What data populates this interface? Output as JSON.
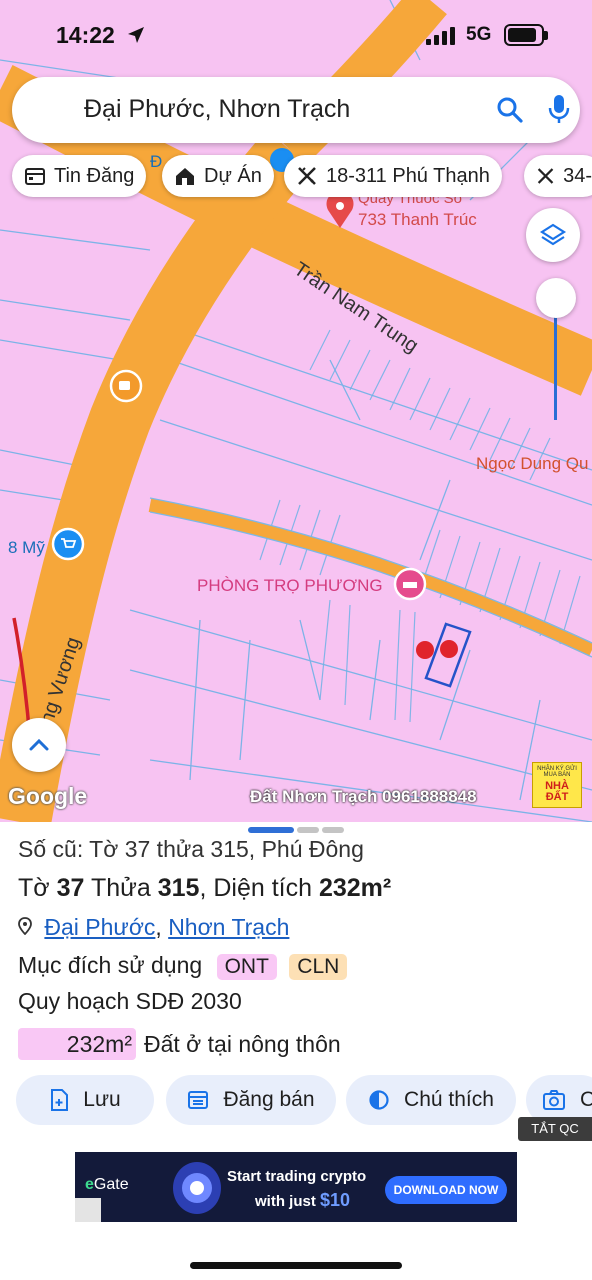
{
  "status_bar": {
    "time": "14:22",
    "network": "5G"
  },
  "search": {
    "query": "Đại Phước, Nhơn Trạch"
  },
  "chips": [
    {
      "label": "Tin Đăng",
      "icon": "calendar-icon"
    },
    {
      "label": "Dự Án",
      "icon": "house-icon"
    },
    {
      "label": "18-311 Phú Thạnh",
      "icon": "ruler-icon"
    },
    {
      "label": "34-",
      "icon": "ruler-icon"
    }
  ],
  "map": {
    "labels": {
      "road_tran_nam_trung": "Trần Nam Trung",
      "road_vuong": "ng Vương",
      "pharmacy_top": "Quầy Thuốc Số",
      "pharmacy": "733 Thanh Trúc",
      "ngoc_dung": "Ngọc Dung Qu",
      "shop": "8 Mỹ",
      "phong_tro": "PHÒNG TRỌ PHƯƠNG",
      "d_partial": "Đ"
    },
    "google_logo": "Google",
    "watermark": "Đất Nhơn Trạch 0961888848",
    "ad_badge": {
      "line1": "NHẬN KÝ GỬI",
      "line2": "MUA BÁN",
      "line3": "NHÀ ĐẤT"
    },
    "colors": {
      "land": "#f7c3f2",
      "road": "#f6a73a",
      "parcel_line": "#6fb2e6",
      "marker": "#e0242c"
    }
  },
  "sheet": {
    "old_info": "Số cũ: Tờ 37 thửa 315, Phú Đông",
    "title": {
      "to_label": "Tờ",
      "to": "37",
      "thua_label": "Thửa",
      "thua": "315",
      "area_label": "Diện tích",
      "area": "232m²"
    },
    "location": {
      "ward": "Đại Phước",
      "sep": ",",
      "district": "Nhơn Trạch"
    },
    "purpose_label": "Mục đích sử dụng",
    "purpose_tags": [
      {
        "text": "ONT",
        "color": "#f9c8f5"
      },
      {
        "text": "CLN",
        "color": "#fde0b5"
      }
    ],
    "plan_label": "Quy hoạch SDĐ 2030",
    "plan_area": "232m²",
    "plan_desc": "Đất ở tại nông thôn",
    "actions": [
      {
        "label": "Lưu",
        "icon": "save-icon"
      },
      {
        "label": "Đăng bán",
        "icon": "calendar-icon"
      },
      {
        "label": "Chú thích",
        "icon": "contrast-icon"
      },
      {
        "label": "C",
        "icon": "camera-icon"
      }
    ],
    "hide_ads": "TẮT QC"
  },
  "ad": {
    "brand": "Gate",
    "headline_1": "Start trading crypto",
    "headline_2": "with just",
    "amount": "$10",
    "cta": "DOWNLOAD NOW"
  }
}
